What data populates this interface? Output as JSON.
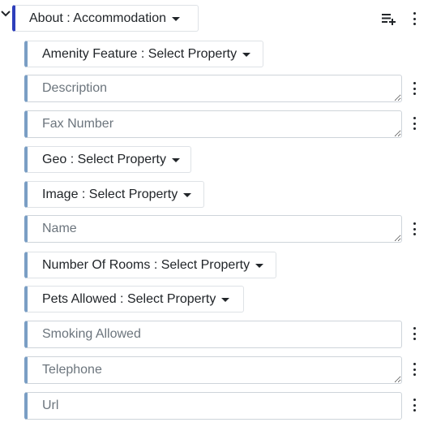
{
  "root": {
    "label": "About : Accommodation"
  },
  "icons": {
    "collapse": "chevron-down-icon",
    "add_list": "playlist-add-icon",
    "more": "kebab-menu-icon"
  },
  "rows": [
    {
      "type": "dropdown",
      "label": "Amenity Feature : Select Property"
    },
    {
      "type": "textarea",
      "placeholder": "Description"
    },
    {
      "type": "textarea",
      "placeholder": "Fax Number"
    },
    {
      "type": "dropdown",
      "label": "Geo : Select Property"
    },
    {
      "type": "dropdown",
      "label": "Image : Select Property"
    },
    {
      "type": "textarea",
      "placeholder": "Name"
    },
    {
      "type": "dropdown",
      "label": "Number Of Rooms : Select Property"
    },
    {
      "type": "dropdown",
      "label": "Pets Allowed : Select Property"
    },
    {
      "type": "input",
      "placeholder": "Smoking Allowed"
    },
    {
      "type": "textarea",
      "placeholder": "Telephone"
    },
    {
      "type": "input",
      "placeholder": "Url"
    }
  ],
  "colors": {
    "root_accent": "#2e3fbb",
    "row_accent": "#7a9ec4"
  }
}
